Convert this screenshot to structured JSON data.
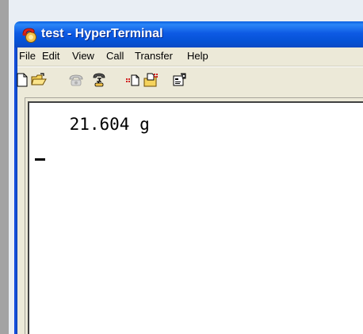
{
  "window": {
    "title": "test - HyperTerminal",
    "app_icon": "hyperterminal-phone-icon"
  },
  "menu": [
    "File",
    "Edit",
    "View",
    "Call",
    "Transfer",
    "Help"
  ],
  "toolbar": [
    {
      "name": "new-connection",
      "icon": "blank-document-icon"
    },
    {
      "name": "open",
      "icon": "open-folder-icon"
    },
    {
      "name": "call",
      "icon": "telephone-icon"
    },
    {
      "name": "disconnect",
      "icon": "hangup-phone-icon"
    },
    {
      "name": "send-file",
      "icon": "send-document-icon"
    },
    {
      "name": "receive-file",
      "icon": "receive-folder-icon"
    },
    {
      "name": "properties",
      "icon": "properties-icon"
    }
  ],
  "terminal": {
    "lines": [
      "    21.604 g"
    ],
    "cursor": "_"
  }
}
